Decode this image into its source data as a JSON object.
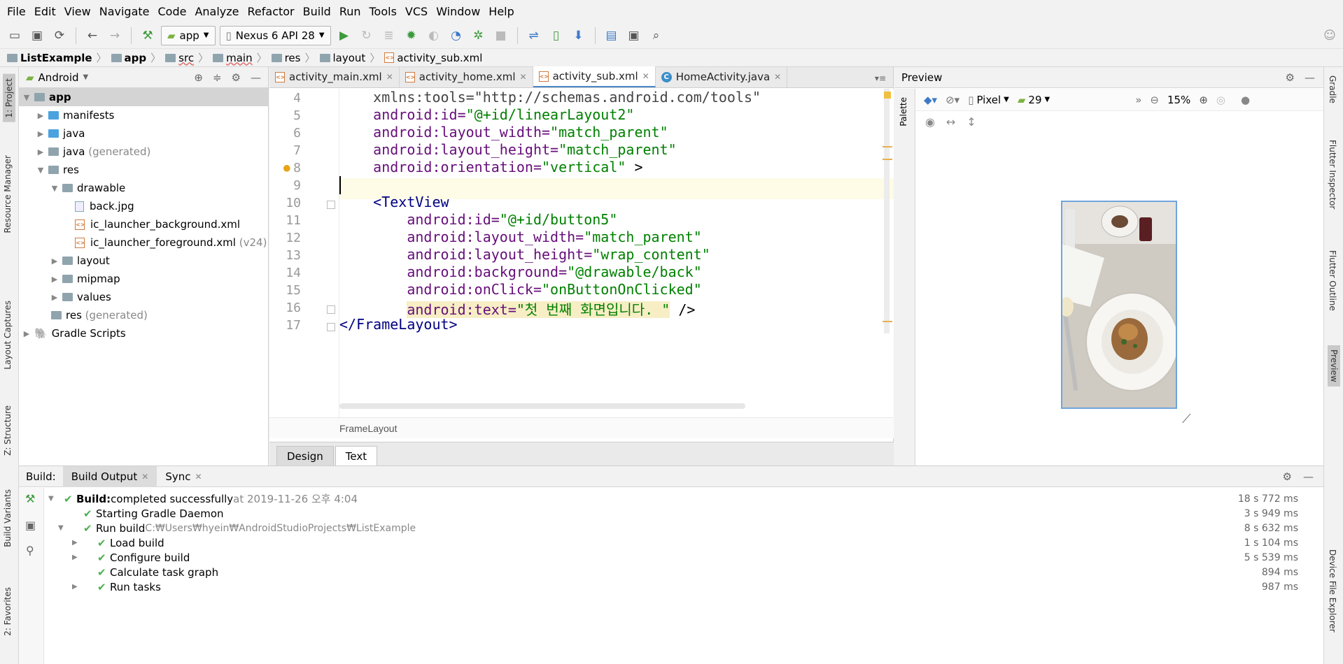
{
  "menu": [
    "File",
    "Edit",
    "View",
    "Navigate",
    "Code",
    "Analyze",
    "Refactor",
    "Build",
    "Run",
    "Tools",
    "VCS",
    "Window",
    "Help"
  ],
  "toolbar": {
    "config": "app",
    "device": "Nexus 6 API 28"
  },
  "breadcrumb": [
    "ListExample",
    "app",
    "src",
    "main",
    "res",
    "layout",
    "activity_sub.xml"
  ],
  "left_tabs": [
    "1: Project",
    "Resource Manager",
    "Layout Captures",
    "Z: Structure",
    "Build Variants",
    "2: Favorites"
  ],
  "right_tabs": [
    "Gradle",
    "Flutter Inspector",
    "Flutter Outline",
    "Preview",
    "Device File Explorer"
  ],
  "project": {
    "view": "Android",
    "tree": [
      {
        "label": "app",
        "extra": ""
      },
      {
        "label": "manifests",
        "extra": ""
      },
      {
        "label": "java",
        "extra": ""
      },
      {
        "label": "java",
        "extra": "(generated)"
      },
      {
        "label": "res",
        "extra": ""
      },
      {
        "label": "drawable",
        "extra": ""
      },
      {
        "label": "back.jpg",
        "extra": ""
      },
      {
        "label": "ic_launcher_background.xml",
        "extra": ""
      },
      {
        "label": "ic_launcher_foreground.xml",
        "extra": "(v24)"
      },
      {
        "label": "layout",
        "extra": ""
      },
      {
        "label": "mipmap",
        "extra": ""
      },
      {
        "label": "values",
        "extra": ""
      },
      {
        "label": "res",
        "extra": "(generated)"
      },
      {
        "label": "Gradle Scripts",
        "extra": ""
      }
    ]
  },
  "editor": {
    "tabs": [
      "activity_main.xml",
      "activity_home.xml",
      "activity_sub.xml",
      "HomeActivity.java"
    ],
    "line_numbers": [
      "4",
      "5",
      "6",
      "7",
      "8",
      "9",
      "10",
      "11",
      "12",
      "13",
      "14",
      "15",
      "16",
      "17"
    ],
    "lines": {
      "l4_attr": "xmlns:tools=",
      "l4_val": "\"http://schemas.android.com/tools\"",
      "l5_attr": "android:id=",
      "l5_val": "\"@+id/linearLayout2\"",
      "l6_attr": "android:layout_width=",
      "l6_val": "\"match_parent\"",
      "l7_attr": "android:layout_height=",
      "l7_val": "\"match_parent\"",
      "l8_attr": "android:orientation=",
      "l8_val": "\"vertical\"",
      "l8_end": " >",
      "l10_tag": "<TextView",
      "l11_attr": "android:id=",
      "l11_val": "\"@+id/button5\"",
      "l12_attr": "android:layout_width=",
      "l12_val": "\"match_parent\"",
      "l13_attr": "android:layout_height=",
      "l13_val": "\"wrap_content\"",
      "l14_attr": "android:background=",
      "l14_val": "\"@drawable/back\"",
      "l15_attr": "android:onClick=",
      "l15_val": "\"onButtonOnClicked\"",
      "l16_attr": "android:text=",
      "l16_val": "\"첫 번째 화면입니다. \"",
      "l16_end": " />",
      "l17_tag": "</FrameLayout>"
    },
    "footer": "FrameLayout",
    "mode_tabs": [
      "Design",
      "Text"
    ]
  },
  "preview": {
    "title": "Preview",
    "palette": "Palette",
    "device": "Pixel",
    "api": "29",
    "zoom": "15%"
  },
  "build": {
    "label": "Build:",
    "tabs": [
      "Build Output",
      "Sync"
    ],
    "rows": [
      {
        "bold": "Build:",
        "text": " completed successfully",
        "dim": " at 2019-11-26 오후 4:04",
        "time": "18 s 772 ms"
      },
      {
        "bold": "",
        "text": "Starting Gradle Daemon",
        "dim": "",
        "time": "3 s 949 ms"
      },
      {
        "bold": "",
        "text": "Run build",
        "dim": " C:₩Users₩hyein₩AndroidStudioProjects₩ListExample",
        "time": "8 s 632 ms"
      },
      {
        "bold": "",
        "text": "Load build",
        "dim": "",
        "time": "1 s 104 ms"
      },
      {
        "bold": "",
        "text": "Configure build",
        "dim": "",
        "time": "5 s 539 ms"
      },
      {
        "bold": "",
        "text": "Calculate task graph",
        "dim": "",
        "time": "894 ms"
      },
      {
        "bold": "",
        "text": "Run tasks",
        "dim": "",
        "time": "987 ms"
      }
    ]
  },
  "colors": {
    "accent": "#4a88c7",
    "success": "#4caf50",
    "xml_tag": "#000080",
    "xml_attr": "#660e7a",
    "xml_string": "#008000"
  }
}
